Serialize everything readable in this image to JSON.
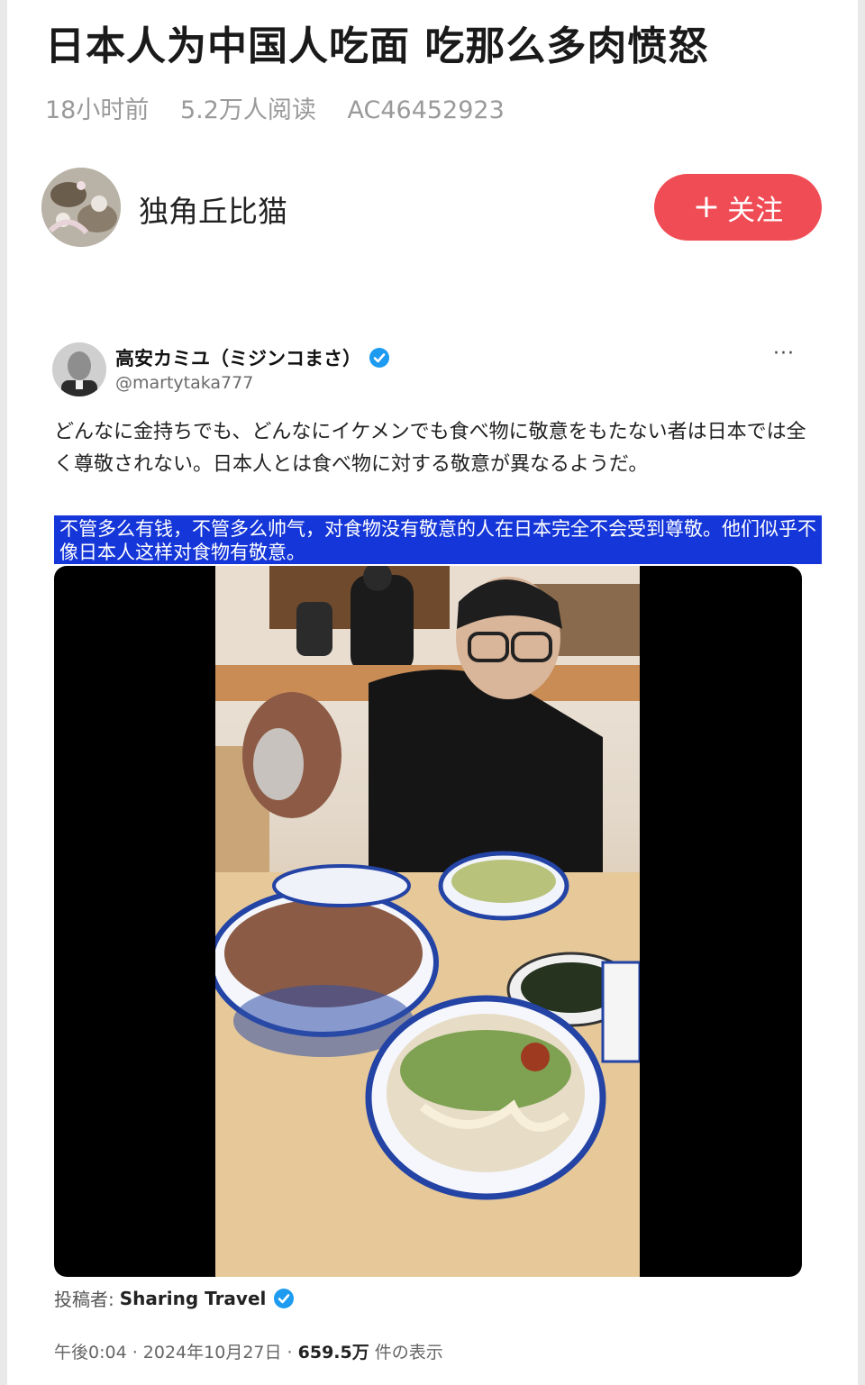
{
  "article": {
    "title": "日本人为中国人吃面 吃那么多肉愤怒",
    "time": "18小时前",
    "reads": "5.2万人阅读",
    "id": "AC46452923"
  },
  "author": {
    "name": "独角丘比猫",
    "avatar_icon": "avatar-image",
    "follow_label": "关注",
    "follow_icon": "plus-icon"
  },
  "colors": {
    "follow": "#f04c55",
    "translation_band": "#1536d8",
    "verified": "#1d9bf0"
  },
  "tweet": {
    "display_name": "高安カミユ（ミジンコまさ）",
    "handle": "@martytaka777",
    "more": "···",
    "text": "どんなに金持ちでも、どんなにイケメンでも食べ物に敬意をもたない者は日本では全く尊敬されない。日本人とは食べ物に対する敬意が異なるようだ。",
    "translation": "不管多么有钱，不管多么帅气，对食物没有敬意的人在日本完全不会受到尊敬。他们似乎不像日本人这样对食物有敬意。",
    "source_label": "投稿者:",
    "source_name": "Sharing Travel",
    "footer_time": "午後0:04 · 2024年10月27日 · ",
    "footer_views": "659.5万",
    "footer_suffix": " 件の表示"
  }
}
